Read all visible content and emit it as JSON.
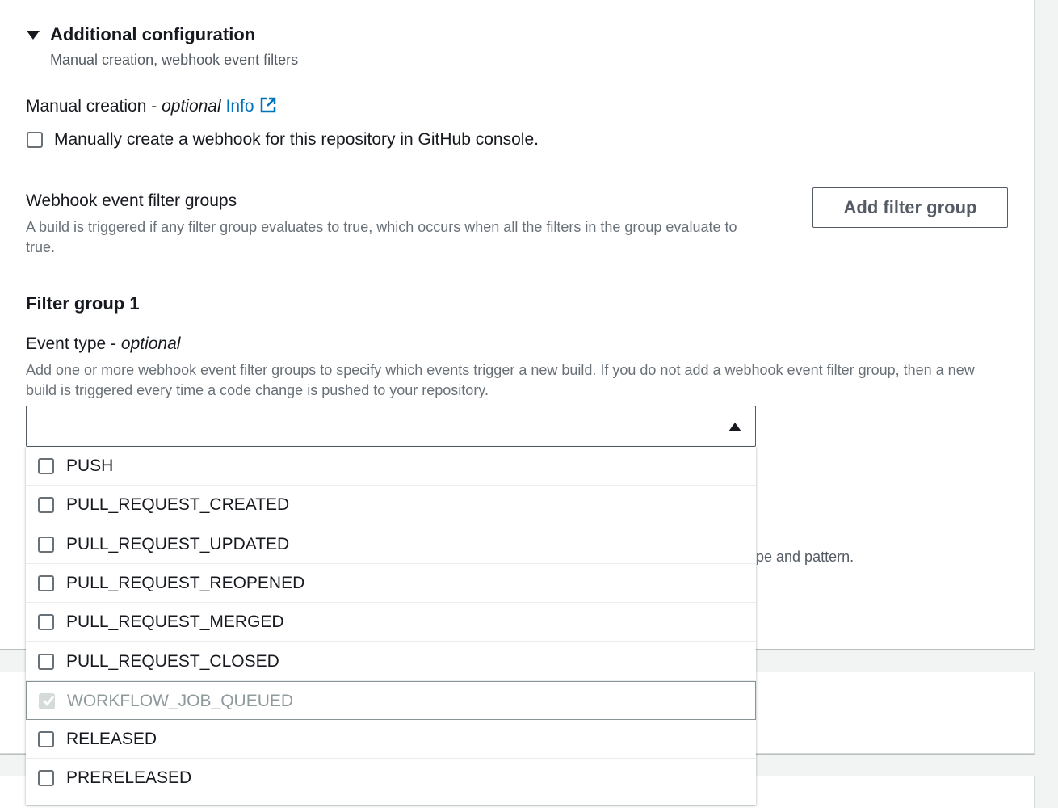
{
  "additional_config": {
    "title": "Additional configuration",
    "description": "Manual creation, webhook event filters"
  },
  "manual_creation": {
    "label": "Manual creation - ",
    "optional": "optional",
    "info": "Info",
    "checkbox_label": "Manually create a webhook for this repository in GitHub console."
  },
  "webhook_groups": {
    "title": "Webhook event filter groups",
    "description": "A build is triggered if any filter group evaluates to true, which occurs when all the filters in the group evaluate to true.",
    "add_button": "Add filter group"
  },
  "filter_group": {
    "title": "Filter group 1",
    "event_type_label": "Event type - ",
    "event_type_optional": "optional",
    "event_type_description": "Add one or more webhook event filter groups to specify which events trigger a new build. If you do not add a webhook event filter group, then a new build is triggered every time a code change is pushed to your repository.",
    "partial_text": "pe and pattern."
  },
  "event_options": [
    {
      "label": "PUSH",
      "checked": false,
      "disabled": false
    },
    {
      "label": "PULL_REQUEST_CREATED",
      "checked": false,
      "disabled": false
    },
    {
      "label": "PULL_REQUEST_UPDATED",
      "checked": false,
      "disabled": false
    },
    {
      "label": "PULL_REQUEST_REOPENED",
      "checked": false,
      "disabled": false
    },
    {
      "label": "PULL_REQUEST_MERGED",
      "checked": false,
      "disabled": false
    },
    {
      "label": "PULL_REQUEST_CLOSED",
      "checked": false,
      "disabled": false
    },
    {
      "label": "WORKFLOW_JOB_QUEUED",
      "checked": true,
      "disabled": true
    },
    {
      "label": "RELEASED",
      "checked": false,
      "disabled": false
    },
    {
      "label": "PRERELEASED",
      "checked": false,
      "disabled": false
    }
  ],
  "colors": {
    "link": "#0073bb",
    "text": "#16191f",
    "muted": "#687078"
  }
}
